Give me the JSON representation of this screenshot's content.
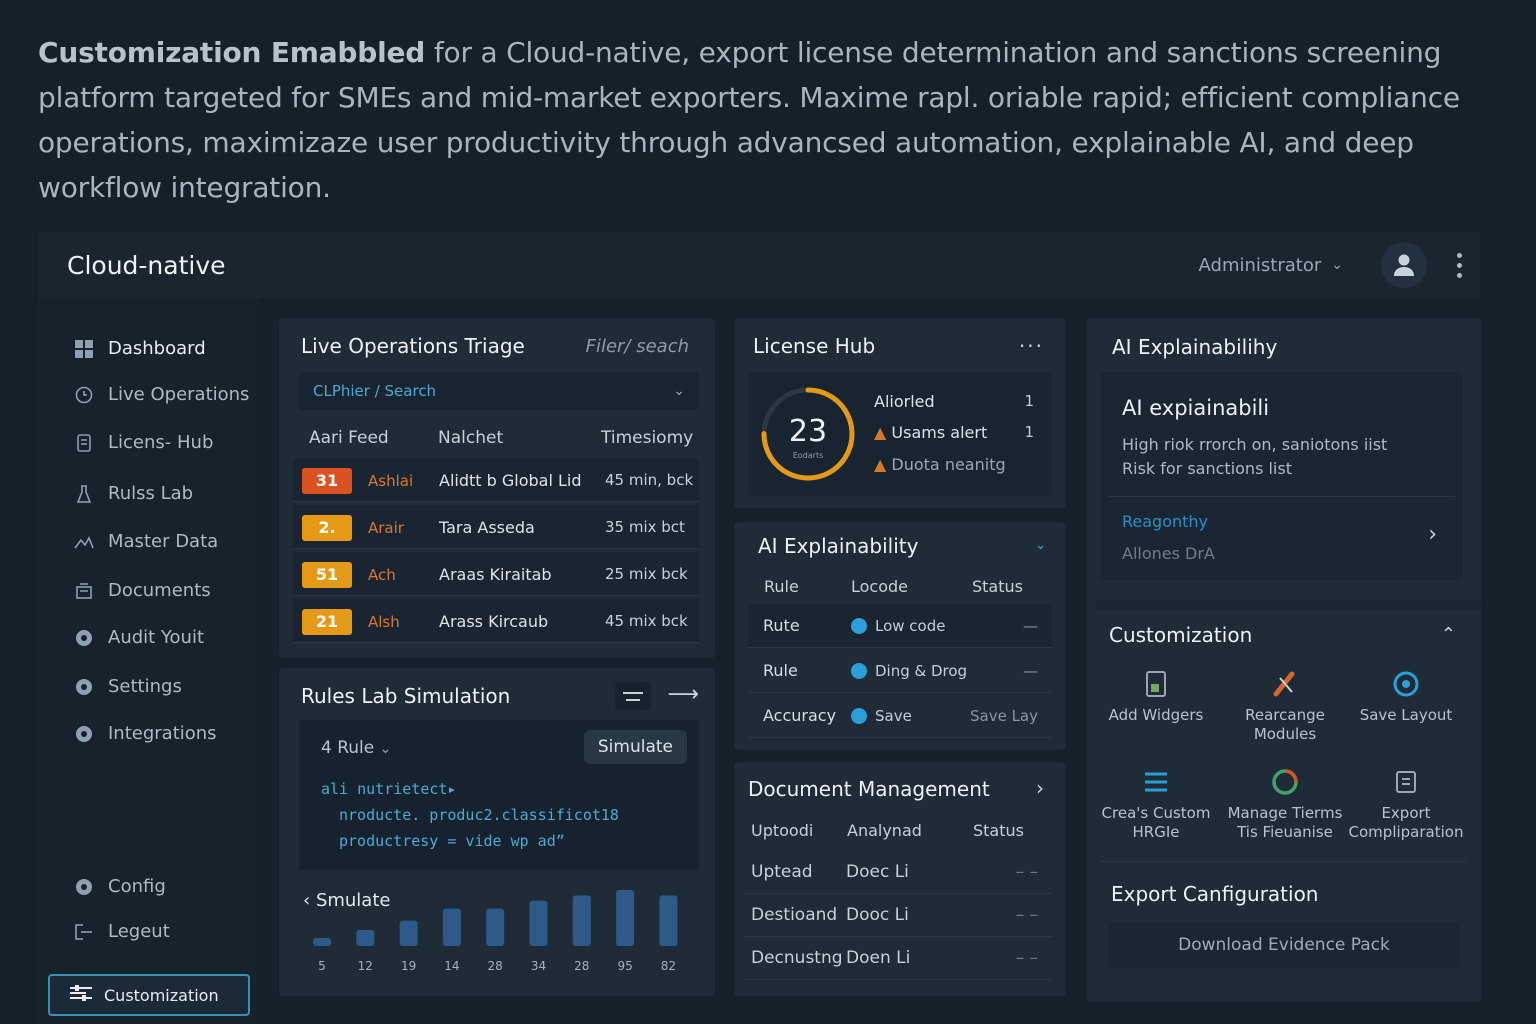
{
  "intro": {
    "bold": "Customization Emabbled",
    "text": " for a Cloud-native, export license determination and sanctions screening platform targeted for SMEs and mid-market exporters. Maxime rapl. oriable rapid; efficient compliance operations, maximizaze user productivity through advancsed automation, explainable AI, and deep workflow integration."
  },
  "topbar": {
    "app_title": "Cloud-native",
    "role": "Administrator"
  },
  "sidebar": {
    "items": [
      {
        "label": "Dashboard"
      },
      {
        "label": "Live Operations"
      },
      {
        "label": "Licens- Hub"
      },
      {
        "label": "Rulss Lab"
      },
      {
        "label": "Master Data"
      },
      {
        "label": "Documents"
      },
      {
        "label": "Audit Youit"
      },
      {
        "label": "Settings"
      },
      {
        "label": "Integrations"
      },
      {
        "label": "Config"
      },
      {
        "label": "Legeut"
      }
    ],
    "customization_label": "Customization"
  },
  "live_ops": {
    "title": "Live Operations Triage",
    "filter_label": "Filer/ seach",
    "search_placeholder": "CLPhier / Search",
    "columns": [
      "Aari Feed",
      "Nalchet",
      "Timesiomy"
    ],
    "rows": [
      {
        "badge": "31",
        "badge_color": "#d9521f",
        "tag": "Ashlai",
        "name": "Alidtt b Global Lid",
        "time": "45 min, bck"
      },
      {
        "badge": "2.",
        "badge_color": "#e59a17",
        "tag": "Arair",
        "name": "Tara Asseda",
        "time": "35 mix bct"
      },
      {
        "badge": "51",
        "badge_color": "#e59a17",
        "tag": "Ach",
        "name": "Araas Kiraitab",
        "time": "25 mix bck"
      },
      {
        "badge": "21",
        "badge_color": "#e59a17",
        "tag": "Alsh",
        "name": "Arass Kircaub",
        "time": "45 mix bck"
      }
    ]
  },
  "rules_lab": {
    "title": "Rules Lab Simulation",
    "rule_select": "4 Rule",
    "simulate_button": "Simulate",
    "code_lines": [
      "ali nutrietect▸",
      "nroducte. produc2.classificot18",
      "productresy = vide wp adˮ"
    ],
    "simulate_label": "Smulate",
    "chart_data": {
      "type": "bar",
      "categories": [
        "5",
        "12",
        "19",
        "14",
        "28",
        "34",
        "28",
        "95",
        "82"
      ],
      "values": [
        5,
        12,
        19,
        28,
        28,
        34,
        38,
        42,
        38
      ]
    }
  },
  "license_hub": {
    "title": "License Hub",
    "gauge_value": "23",
    "gauge_caption": "Eodarts",
    "gauge_fraction": 0.75,
    "items": [
      {
        "label": "Aliorled",
        "count": "1"
      },
      {
        "label": "Usams alert",
        "count": "1"
      },
      {
        "label": "Duota neanitg",
        "count": ""
      }
    ]
  },
  "ai_mid": {
    "title": "AI Explainability",
    "columns": [
      "Rule",
      "Locode",
      "Status"
    ],
    "rows": [
      {
        "key": "Rute",
        "value": "Low code",
        "status": "—"
      },
      {
        "key": "Rule",
        "value": "Ding & Drog",
        "status": "—"
      },
      {
        "key": "Accuracy",
        "value": "Save",
        "status": "Save Lay"
      }
    ]
  },
  "documents": {
    "title": "Document Management",
    "columns": [
      "Uptoodi",
      "Analynad",
      "Status"
    ],
    "rows": [
      {
        "a": "Uptead",
        "b": "Doec Li",
        "c": "– –"
      },
      {
        "a": "Destioand",
        "b": "Dooc Li",
        "c": "– –"
      },
      {
        "a": "Decnustng",
        "b": "Doen Li",
        "c": "– –"
      }
    ]
  },
  "right_panel": {
    "title": "AI Explainabilihy",
    "box_title": "AI  expiainabili",
    "box_line1": "High riok rrorch on, saniotons iist",
    "box_line2": "Risk for sanctions list",
    "link_title": "Reagonthy",
    "link_sub": "Allones DrA",
    "customization_title": "Customization",
    "custom_items": [
      {
        "label": "Add Widgers",
        "icon": "widget-icon"
      },
      {
        "label": "Rearcange Modules",
        "icon": "rearrange-icon"
      },
      {
        "label": "Save Layout",
        "icon": "save-layout-icon"
      },
      {
        "label": "Crea's Custom HRGIe",
        "icon": "custom-rule-icon"
      },
      {
        "label": "Manage Tierms Tis Fieuanise",
        "icon": "manage-terms-icon"
      },
      {
        "label": "Export Compliparation",
        "icon": "export-icon"
      }
    ],
    "export_title": "Export Canfiguration",
    "download_button": "Download Evidence Pack"
  }
}
